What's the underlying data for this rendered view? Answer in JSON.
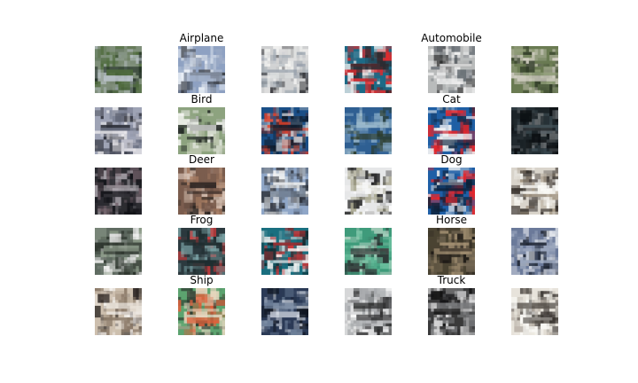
{
  "figure": {
    "columns_per_class": 3,
    "classes": [
      {
        "label": "Airplane"
      },
      {
        "label": "Automobile"
      },
      {
        "label": "Bird"
      },
      {
        "label": "Cat"
      },
      {
        "label": "Deer"
      },
      {
        "label": "Dog"
      },
      {
        "label": "Frog"
      },
      {
        "label": "Horse"
      },
      {
        "label": "Ship"
      },
      {
        "label": "Truck"
      }
    ],
    "samples": [
      {
        "base": "#7f8f7a",
        "c1": "#1d2a22",
        "c2": "#b9c2c8",
        "c3": "#4f6b3d"
      },
      {
        "base": "#8ea1c2",
        "c1": "#e9eef5",
        "c2": "#3b3f47",
        "c3": "#a6b3c9"
      },
      {
        "base": "#cfd0d1",
        "c1": "#f2f2f0",
        "c2": "#2f3034",
        "c3": "#9aa3ad"
      },
      {
        "base": "#1d6a86",
        "c1": "#e12a2c",
        "c2": "#f3f3f3",
        "c3": "#2d2a2f"
      },
      {
        "base": "#b9bbbb",
        "c1": "#2b2b2c",
        "c2": "#f1f1f1",
        "c3": "#6a7076"
      },
      {
        "base": "#6a7b52",
        "c1": "#2f3a26",
        "c2": "#d6d2c7",
        "c3": "#8e9c76"
      },
      {
        "base": "#9ea3b5",
        "c1": "#e7e6ea",
        "c2": "#2b2d36",
        "c3": "#6f7587"
      },
      {
        "base": "#8da37f",
        "c1": "#202522",
        "c2": "#f4f5f2",
        "c3": "#b6c1a8"
      },
      {
        "base": "#1a4f87",
        "c1": "#e1412a",
        "c2": "#c7cbd0",
        "c3": "#0f1b2a"
      },
      {
        "base": "#2f5f92",
        "c1": "#7aa0c0",
        "c2": "#2b3b2a",
        "c3": "#a3c0d0"
      },
      {
        "base": "#1f5fa4",
        "c1": "#e3262b",
        "c2": "#f1f1f1",
        "c3": "#0d2540"
      },
      {
        "base": "#1c2428",
        "c1": "#3c4b52",
        "c2": "#666b6e",
        "c3": "#0b0f12"
      },
      {
        "base": "#2c2c31",
        "c1": "#6a5a63",
        "c2": "#a7a2a9",
        "c3": "#111217"
      },
      {
        "base": "#7b5d4e",
        "c1": "#d8c3b5",
        "c2": "#2c2522",
        "c3": "#a57b61"
      },
      {
        "base": "#8fa6c7",
        "c1": "#f1f2f2",
        "c2": "#2c3038",
        "c3": "#6d7a8c"
      },
      {
        "base": "#e6e7e8",
        "c1": "#ffffff",
        "c2": "#2b2b2b",
        "c3": "#a7a58d"
      },
      {
        "base": "#1f5fa6",
        "c1": "#e3262b",
        "c2": "#f1f1f1",
        "c3": "#0b1e34"
      },
      {
        "base": "#d9d4cb",
        "c1": "#fbfbf8",
        "c2": "#3a342f",
        "c3": "#a29583"
      },
      {
        "base": "#5f6b61",
        "c1": "#f0f0ef",
        "c2": "#2b332b",
        "c3": "#8f9e8c"
      },
      {
        "base": "#2c3a3f",
        "c1": "#d63a3b",
        "c2": "#1e2d2f",
        "c3": "#7aa1a4"
      },
      {
        "base": "#1a6f7f",
        "c1": "#f5f5f4",
        "c2": "#d83233",
        "c3": "#0d2a2f"
      },
      {
        "base": "#3f9b7b",
        "c1": "#b3d2c2",
        "c2": "#2c2f30",
        "c3": "#6cc1a0"
      },
      {
        "base": "#4a4332",
        "c1": "#a08d70",
        "c2": "#1e1a16",
        "c3": "#6b604e"
      },
      {
        "base": "#6b7a9a",
        "c1": "#e3e6ec",
        "c2": "#1f2633",
        "c3": "#9aa6bd"
      },
      {
        "base": "#cdbfae",
        "c1": "#f5f2ee",
        "c2": "#2a2421",
        "c3": "#8b7a69"
      },
      {
        "base": "#5ca36f",
        "c1": "#e6d7bf",
        "c2": "#e0603b",
        "c3": "#2c3a2f"
      },
      {
        "base": "#2b3a56",
        "c1": "#d7dde6",
        "c2": "#0f1520",
        "c3": "#6d7f99"
      },
      {
        "base": "#d6d7d8",
        "c1": "#ffffff",
        "c2": "#2a2b2c",
        "c3": "#a3a6a9"
      },
      {
        "base": "#3a3a3b",
        "c1": "#d7d7d8",
        "c2": "#121213",
        "c3": "#797a7c"
      },
      {
        "base": "#e7e3db",
        "c1": "#fbfaf7",
        "c2": "#3a3531",
        "c3": "#b8b0a6"
      }
    ]
  }
}
